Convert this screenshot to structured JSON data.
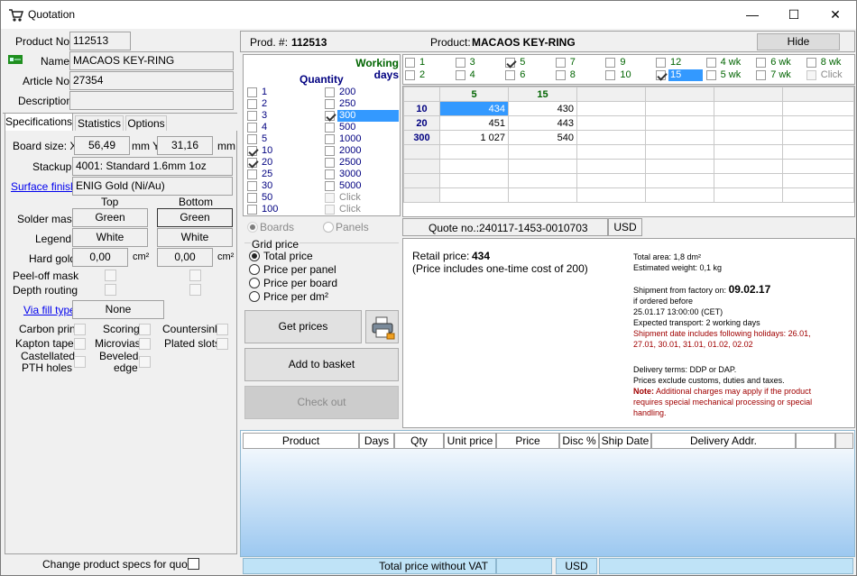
{
  "window": {
    "title": "Quotation",
    "minimize": "—",
    "maximize": "☐",
    "close": "✕"
  },
  "left": {
    "product_no_label": "Product No.",
    "product_no": "112513",
    "name_label": "Name",
    "name": "MACAOS KEY-RING",
    "article_no_label": "Article No.",
    "article_no": "27354",
    "description_label": "Description",
    "description": "",
    "tabs": [
      "Specifications",
      "Statistics",
      "Options"
    ],
    "board_size_label": "Board size: X",
    "board_x": "56,49",
    "mm_y": "mm Y",
    "board_y": "31,16",
    "mm": "mm",
    "stackup_label": "Stackup",
    "stackup": "4001: Standard 1.6mm 1oz",
    "surface_finish_label": "Surface finish",
    "surface_finish": "ENIG Gold (Ni/Au)",
    "top_label": "Top",
    "bottom_label": "Bottom",
    "solder_mask_label": "Solder mask",
    "solder_top": "Green",
    "solder_bottom": "Green",
    "legend_label": "Legend",
    "legend_top": "White",
    "legend_bottom": "White",
    "hard_gold_label": "Hard gold",
    "gold_top": "0,00",
    "gold_bottom": "0,00",
    "cm2": "cm²",
    "peel_off_label": "Peel-off mask",
    "depth_routing_label": "Depth routing",
    "via_fill_label": "Via fill type",
    "via_fill": "None",
    "carbon_label": "Carbon print",
    "scoring_label": "Scoring",
    "countersink_label": "Countersink",
    "kapton_label": "Kapton tape",
    "microvias_label": "Microvias",
    "plated_slots_label": "Plated slots",
    "castellated_label_1": "Castellated",
    "castellated_label_2": "PTH holes",
    "beveled_label_1": "Beveled",
    "beveled_label_2": "edge",
    "change_specs_label": "Change product specs for quote"
  },
  "header": {
    "prod_label": "Prod. #:",
    "prod_no": "112513",
    "product_label": "Product:",
    "product_name": "MACAOS KEY-RING",
    "hide": "Hide"
  },
  "quantity": {
    "working_days_1": "Working",
    "working_days_2": "days",
    "title": "Quantity",
    "col1": [
      {
        "v": "1",
        "c": false
      },
      {
        "v": "2",
        "c": false
      },
      {
        "v": "3",
        "c": false
      },
      {
        "v": "4",
        "c": false
      },
      {
        "v": "5",
        "c": false
      },
      {
        "v": "10",
        "c": true
      },
      {
        "v": "20",
        "c": true
      },
      {
        "v": "25",
        "c": false
      },
      {
        "v": "30",
        "c": false
      },
      {
        "v": "50",
        "c": false
      },
      {
        "v": "100",
        "c": false
      }
    ],
    "col2": [
      {
        "v": "200",
        "c": false
      },
      {
        "v": "250",
        "c": false
      },
      {
        "v": "300",
        "c": true,
        "sel": true
      },
      {
        "v": "500",
        "c": false
      },
      {
        "v": "1000",
        "c": false
      },
      {
        "v": "2000",
        "c": false
      },
      {
        "v": "2500",
        "c": false
      },
      {
        "v": "3000",
        "c": false
      },
      {
        "v": "5000",
        "c": false
      },
      {
        "v": "Click",
        "c": false,
        "dis": true
      },
      {
        "v": "Click",
        "c": false,
        "dis": true
      }
    ]
  },
  "days": {
    "row1": [
      {
        "v": "1",
        "c": false
      },
      {
        "v": "3",
        "c": false
      },
      {
        "v": "5",
        "c": true
      },
      {
        "v": "7",
        "c": false
      },
      {
        "v": "9",
        "c": false
      },
      {
        "v": "12",
        "c": false
      },
      {
        "v": "4 wk",
        "c": false
      },
      {
        "v": "6 wk",
        "c": false
      },
      {
        "v": "8 wk",
        "c": false
      }
    ],
    "row2": [
      {
        "v": "2",
        "c": false
      },
      {
        "v": "4",
        "c": false
      },
      {
        "v": "6",
        "c": false
      },
      {
        "v": "8",
        "c": false
      },
      {
        "v": "10",
        "c": false
      },
      {
        "v": "15",
        "c": true,
        "sel": true
      },
      {
        "v": "5 wk",
        "c": false
      },
      {
        "v": "7 wk",
        "c": false
      },
      {
        "v": "Click",
        "c": false,
        "dis": true
      }
    ]
  },
  "price_grid": {
    "col_headers": [
      "5",
      "15"
    ],
    "rows": [
      {
        "qty": "10",
        "vals": [
          "434",
          "430"
        ]
      },
      {
        "qty": "20",
        "vals": [
          "451",
          "443"
        ]
      },
      {
        "qty": "300",
        "vals": [
          "1 027",
          "540"
        ]
      }
    ]
  },
  "options": {
    "boards": "Boards",
    "panels": "Panels",
    "grid_price_title": "Grid price",
    "radios": [
      "Total price",
      "Price per panel",
      "Price per board",
      "Price per dm²"
    ],
    "get_prices": "Get prices",
    "add_to_basket": "Add to basket",
    "check_out": "Check out"
  },
  "quote": {
    "quote_no_label": "Quote no.:",
    "quote_no": "240117-1453-0010703",
    "currency": "USD"
  },
  "info": {
    "retail_label": "Retail price:",
    "retail_value": "434",
    "retail_note": "(Price includes one-time cost of 200)",
    "total_area": "Total area: 1,8 dm²",
    "weight": "Estimated weight: 0,1 kg",
    "ship_label": "Shipment from factory on:",
    "ship_date": "09.02.17",
    "ordered_before": "if ordered before",
    "order_deadline": "25.01.17 13:00:00  (CET)",
    "transport": "Expected transport: 2 working days",
    "holidays_1": "Shipment date includes following holidays: 26.01,",
    "holidays_2": "27.01, 30.01, 31.01, 01.02, 02.02",
    "delivery_terms": "Delivery terms: DDP or DAP.",
    "excludes": "Prices exclude customs, duties and taxes.",
    "note_label": "Note:",
    "note_1": "Additional charges may apply if the product",
    "note_2": "requires special mechanical processing or special",
    "note_3": "handling."
  },
  "basket": {
    "columns": [
      "Product",
      "Days",
      "Qty",
      "Unit price",
      "Price",
      "Disc %",
      "Ship Date",
      "Delivery Addr."
    ],
    "total_label": "Total price without VAT",
    "total_value": "",
    "currency": "USD"
  },
  "colors": {
    "accent": "#3399ff",
    "green": "#006400",
    "navy": "#000080",
    "note_red": "#a00000"
  }
}
